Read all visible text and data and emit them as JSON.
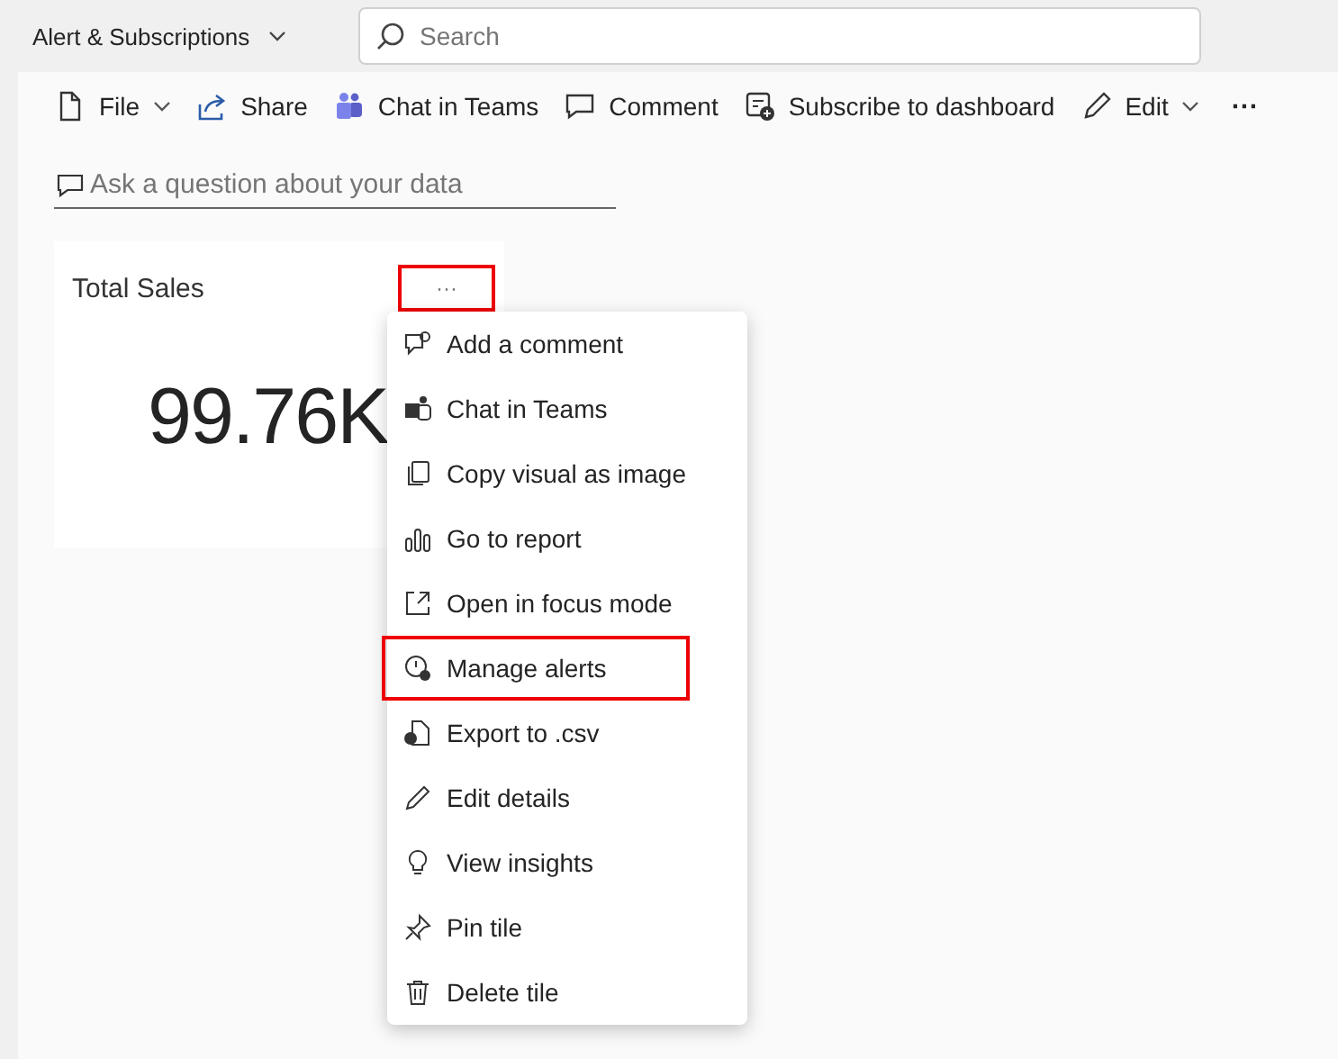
{
  "header": {
    "title": "Alert & Subscriptions",
    "search": {
      "placeholder": "Search"
    }
  },
  "toolbar": [
    {
      "kind": "file",
      "label": "File",
      "dropdown": true
    },
    {
      "kind": "share",
      "label": "Share",
      "dropdown": false
    },
    {
      "kind": "teams",
      "label": "Chat in Teams",
      "dropdown": false
    },
    {
      "kind": "comment",
      "label": "Comment",
      "dropdown": false
    },
    {
      "kind": "subscribe",
      "label": "Subscribe to dashboard",
      "dropdown": false
    },
    {
      "kind": "edit",
      "label": "Edit",
      "dropdown": true
    },
    {
      "kind": "more",
      "label": "···",
      "dropdown": false
    }
  ],
  "qna": {
    "placeholder": "Ask a question about your data"
  },
  "tile": {
    "title": "Total Sales",
    "value": "99.76K",
    "more": "···",
    "more_highlighted": true
  },
  "menu": [
    {
      "kind": "comment",
      "label": "Add a comment",
      "highlighted": false
    },
    {
      "kind": "teams",
      "label": "Chat in Teams",
      "highlighted": false
    },
    {
      "kind": "copy",
      "label": "Copy visual as image",
      "highlighted": false
    },
    {
      "kind": "report",
      "label": "Go to report",
      "highlighted": false
    },
    {
      "kind": "focus",
      "label": "Open in focus mode",
      "highlighted": false
    },
    {
      "kind": "alert",
      "label": "Manage alerts",
      "highlighted": true
    },
    {
      "kind": "export",
      "label": "Export to .csv",
      "highlighted": false
    },
    {
      "kind": "edit",
      "label": "Edit details",
      "highlighted": false
    },
    {
      "kind": "insights",
      "label": "View insights",
      "highlighted": false
    },
    {
      "kind": "pin",
      "label": "Pin tile",
      "highlighted": false
    },
    {
      "kind": "delete",
      "label": "Delete tile",
      "highlighted": false
    }
  ]
}
